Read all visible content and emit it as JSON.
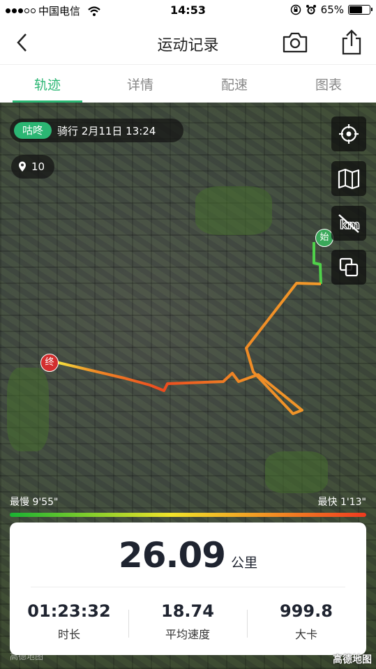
{
  "status_bar": {
    "carrier": "中国电信",
    "time": "14:53",
    "battery": "65%",
    "battery_level": 0.65
  },
  "nav": {
    "title": "运动记录"
  },
  "tabs": [
    {
      "label": "轨迹",
      "active": true
    },
    {
      "label": "详情",
      "active": false
    },
    {
      "label": "配速",
      "active": false
    },
    {
      "label": "图表",
      "active": false
    }
  ],
  "map": {
    "brand": "咕咚",
    "activity": "骑行  2月11日  13:24",
    "location_count": "10",
    "start_marker": "始",
    "end_marker": "终",
    "watermark_left": "高德地图",
    "watermark_right": "高德地图"
  },
  "speed_legend": {
    "slowest": "最慢 9'55\"",
    "fastest": "最快 1'13\""
  },
  "stats": {
    "distance": "26.09",
    "distance_unit": "公里",
    "items": [
      {
        "value": "01:23:32",
        "label": "时长"
      },
      {
        "value": "18.74",
        "label": "平均速度"
      },
      {
        "value": "999.8",
        "label": "大卡"
      }
    ]
  },
  "colors": {
    "accent": "#2bb673",
    "route_start": "#19b232",
    "route_end": "#ef3a1f"
  },
  "icons": [
    "back-icon",
    "camera-icon",
    "share-icon",
    "locate-icon",
    "map-layer-icon",
    "km-toggle-icon",
    "overlay-icon",
    "location-pin-icon"
  ]
}
